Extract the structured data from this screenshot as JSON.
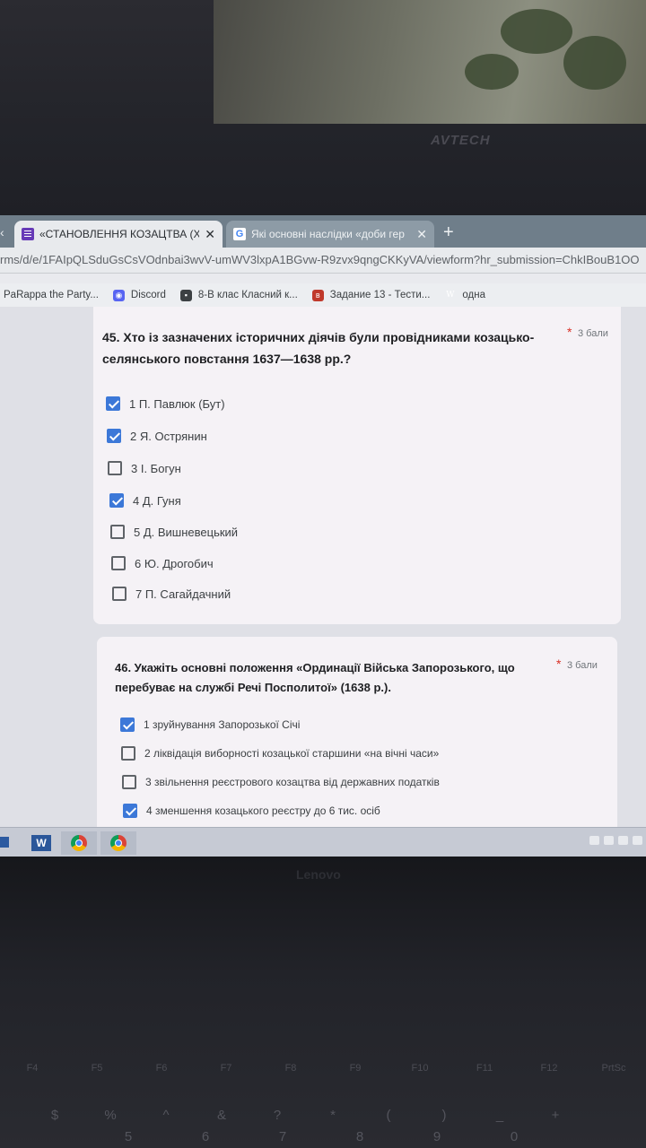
{
  "environment": {
    "bezel_brand": "AVTECH",
    "laptop_brand": "Lenovo",
    "fkeys": [
      "F4",
      "F5",
      "F6",
      "F7",
      "F8",
      "F9",
      "F10",
      "F11",
      "F12",
      "PrtSc"
    ],
    "numkeys": [
      "$",
      "%",
      "^",
      "&",
      "?",
      "*",
      "(",
      ")",
      "_",
      "+"
    ],
    "numkeys_lower": [
      "5",
      "6",
      "7",
      "8",
      "9",
      "0"
    ]
  },
  "browser": {
    "tabs": [
      {
        "title": "«СТАНОВЛЕННЯ КОЗАЦТВА (XV",
        "icon": "google-forms-icon",
        "active": true
      },
      {
        "title": "Які основні наслідки «доби гер",
        "icon": "google-icon",
        "active": false
      }
    ],
    "new_tab_label": "+",
    "url": "rms/d/e/1FAIpQLSduGsCsVOdnbai3wvV-umWV3lxpA1BGvw-R9zvx9qngCKKyVA/viewform?hr_submission=ChkIBouB1OO",
    "bookmarks": [
      {
        "label": "PaRappa the Party...",
        "icon": "none"
      },
      {
        "label": "Discord",
        "icon": "discord-icon"
      },
      {
        "label": "8-В клас Класний к...",
        "icon": "classroom-icon"
      },
      {
        "label": "Задание 13 - Тести...",
        "icon": "task-icon"
      },
      {
        "label": "одна",
        "icon": "wikipedia-icon"
      }
    ]
  },
  "form": {
    "questions": [
      {
        "title": "45. Хто із зазначених історичних діячів були провідниками козацько-селянського повстання 1637—1638 рр.?",
        "required": "*",
        "points": "3 бали",
        "options": [
          {
            "label": "1 П. Павлюк (Бут)",
            "checked": true
          },
          {
            "label": "2 Я. Острянин",
            "checked": true
          },
          {
            "label": "3 І. Богун",
            "checked": false
          },
          {
            "label": "4 Д. Гуня",
            "checked": true
          },
          {
            "label": "5 Д. Вишневецький",
            "checked": false
          },
          {
            "label": "6 Ю. Дрогобич",
            "checked": false
          },
          {
            "label": "7 П. Сагайдачний",
            "checked": false
          }
        ]
      },
      {
        "title": "46. Укажіть основні положення «Ординації Війська Запорозького, що перебуває на службі Речі Посполитої» (1638 р.).",
        "required": "*",
        "points": "3 бали",
        "options": [
          {
            "label": "1 зруйнування Запорозької Січі",
            "checked": true
          },
          {
            "label": "2 ліквідація виборності козацької старшини «на вічні часи»",
            "checked": false
          },
          {
            "label": "3 звільнення реєстрового козацтва від державних податків",
            "checked": false
          },
          {
            "label": "4 зменшення козацького реєстру до 6 тис. осіб",
            "checked": true
          }
        ]
      }
    ]
  },
  "colors": {
    "accent": "#3c78d8",
    "required": "#d93025",
    "card": "#f5f2f6"
  }
}
